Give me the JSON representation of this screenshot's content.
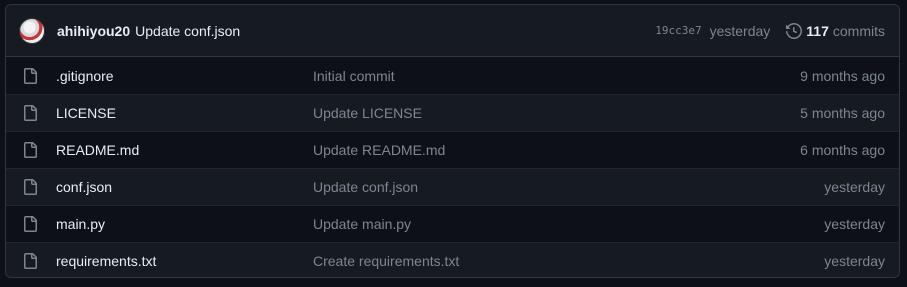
{
  "last_commit": {
    "author": "ahihiyou20",
    "message": "Update conf.json",
    "sha": "19cc3e7",
    "time": "yesterday",
    "commit_count": "117",
    "commits_label": "commits"
  },
  "files": [
    {
      "name": ".gitignore",
      "message": "Initial commit",
      "time": "9 months ago"
    },
    {
      "name": "LICENSE",
      "message": "Update LICENSE",
      "time": "5 months ago"
    },
    {
      "name": "README.md",
      "message": "Update README.md",
      "time": "6 months ago"
    },
    {
      "name": "conf.json",
      "message": "Update conf.json",
      "time": "yesterday"
    },
    {
      "name": "main.py",
      "message": "Update main.py",
      "time": "yesterday"
    },
    {
      "name": "requirements.txt",
      "message": "Create requirements.txt",
      "time": "yesterday"
    }
  ],
  "icons": {
    "file": "file-icon",
    "history": "history-icon"
  },
  "colors": {
    "background": "#0d1117",
    "header_bg": "#161b22",
    "border": "#30363d",
    "muted_text": "#7d8590",
    "text": "#e6edf3"
  }
}
